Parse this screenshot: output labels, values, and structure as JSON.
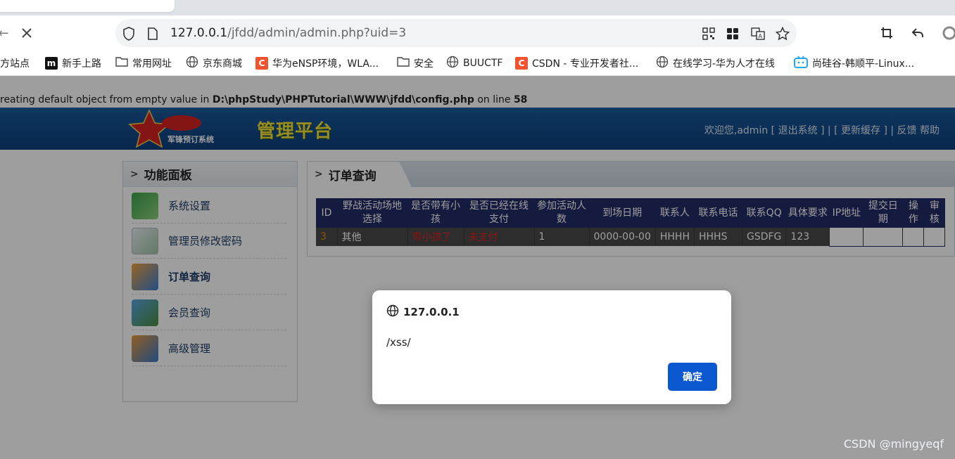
{
  "browser": {
    "url_host": "127.0.0.1",
    "url_path": "/jfdd/admin/admin.php?uid=3",
    "bookmarks": [
      {
        "label": "方站点",
        "icon": "none"
      },
      {
        "label": "新手上路",
        "icon": "m-logo-icon"
      },
      {
        "label": "常用网址",
        "icon": "folder-icon"
      },
      {
        "label": "京东商城",
        "icon": "globe-icon"
      },
      {
        "label": "华为eNSP环境，WLA...",
        "icon": "csdn-icon"
      },
      {
        "label": "安全",
        "icon": "folder-icon"
      },
      {
        "label": "BUUCTF",
        "icon": "globe-icon"
      },
      {
        "label": "CSDN - 专业开发者社...",
        "icon": "csdn-icon"
      },
      {
        "label": "在线学习-华为人才在线",
        "icon": "globe-icon"
      },
      {
        "label": "尚硅谷-韩顺平-Linux...",
        "icon": "bilibili-icon"
      }
    ]
  },
  "warning": {
    "prefix": "reating default object from empty value in ",
    "path": "D:\\phpStudy\\PHPTutorial\\WWW\\jfdd\\config.php",
    "mid": " on line ",
    "line": "58"
  },
  "header": {
    "logo_sub": "军锋预订系统",
    "title": "管理平台",
    "links": "欢迎您,admin [ 退出系统 ] | [ 更新缓存 ] |  反馈   帮助"
  },
  "sidebar": {
    "title": "功能面板",
    "items": [
      {
        "label": "系统设置"
      },
      {
        "label": "管理员修改密码"
      },
      {
        "label": "订单查询"
      },
      {
        "label": "会员查询"
      },
      {
        "label": "高级管理"
      }
    ]
  },
  "main": {
    "tab_title": "订单查询",
    "table": {
      "headers": [
        "ID",
        "野战活动场地选择",
        "是否带有小孩",
        "是否已经在线支付",
        "参加活动人数",
        "到场日期",
        "联系人",
        "联系电话",
        "联系QQ",
        "具体要求",
        "IP地址",
        "提交日期",
        "操作",
        "审核"
      ],
      "rows": [
        [
          "3",
          "其他",
          "带小孩了",
          "未支付",
          "1",
          "0000-00-00",
          "HHHH",
          "HHHS",
          "GSDFG",
          "123",
          "",
          "",
          "",
          ""
        ]
      ]
    }
  },
  "dialog": {
    "origin": "127.0.0.1",
    "message": "/xss/",
    "ok_label": "确定"
  },
  "watermark": "CSDN @mingyeqf"
}
